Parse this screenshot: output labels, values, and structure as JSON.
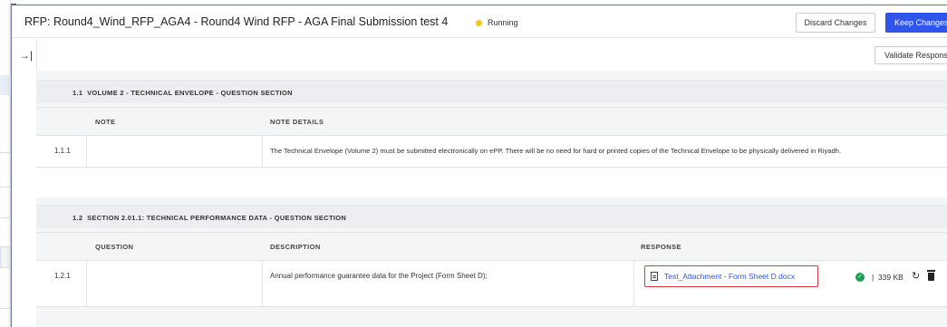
{
  "header": {
    "title": "RFP: Round4_Wind_RFP_AGA4 - Round4 Wind RFP - AGA Final Submission test 4",
    "status": "Running",
    "status_color": "#f5c518",
    "discard_label": "Discard Changes",
    "keep_label": "Keep Changes",
    "keep_color": "#2f54eb"
  },
  "toolbar": {
    "collapse_icon": "collapse-sidebar-icon",
    "validate_label": "Validate Response"
  },
  "sections": [
    {
      "number": "1.1",
      "title": "VOLUME 2 - TECHNICAL ENVELOPE - QUESTION SECTION",
      "columns": [
        "NOTE",
        "NOTE DETAILS"
      ],
      "rows": [
        {
          "id": "1.1.1",
          "note": "",
          "details": "The Technical Envelope (Volume 2) must be submitted electronically on ePP. There will be no need for hard or printed copies of the Technical Envelope to be physically delivered in Riyadh."
        }
      ]
    },
    {
      "number": "1.2",
      "title": "SECTION 2.01.1: TECHNICAL PERFORMANCE DATA - QUESTION SECTION",
      "columns": [
        "QUESTION",
        "DESCRIPTION",
        "RESPONSE"
      ],
      "rows": [
        {
          "id": "1.2.1",
          "question": "",
          "description": "Annual performance guarantee data for the Project (Form Sheet D);",
          "attachment": {
            "name": "Test_Attachment - Form Sheet D.docx",
            "size": "339 KB",
            "icon": "document-icon",
            "status_icon": "check-circle-icon",
            "actions": [
              "refresh-icon",
              "trash-icon"
            ]
          }
        }
      ]
    }
  ]
}
